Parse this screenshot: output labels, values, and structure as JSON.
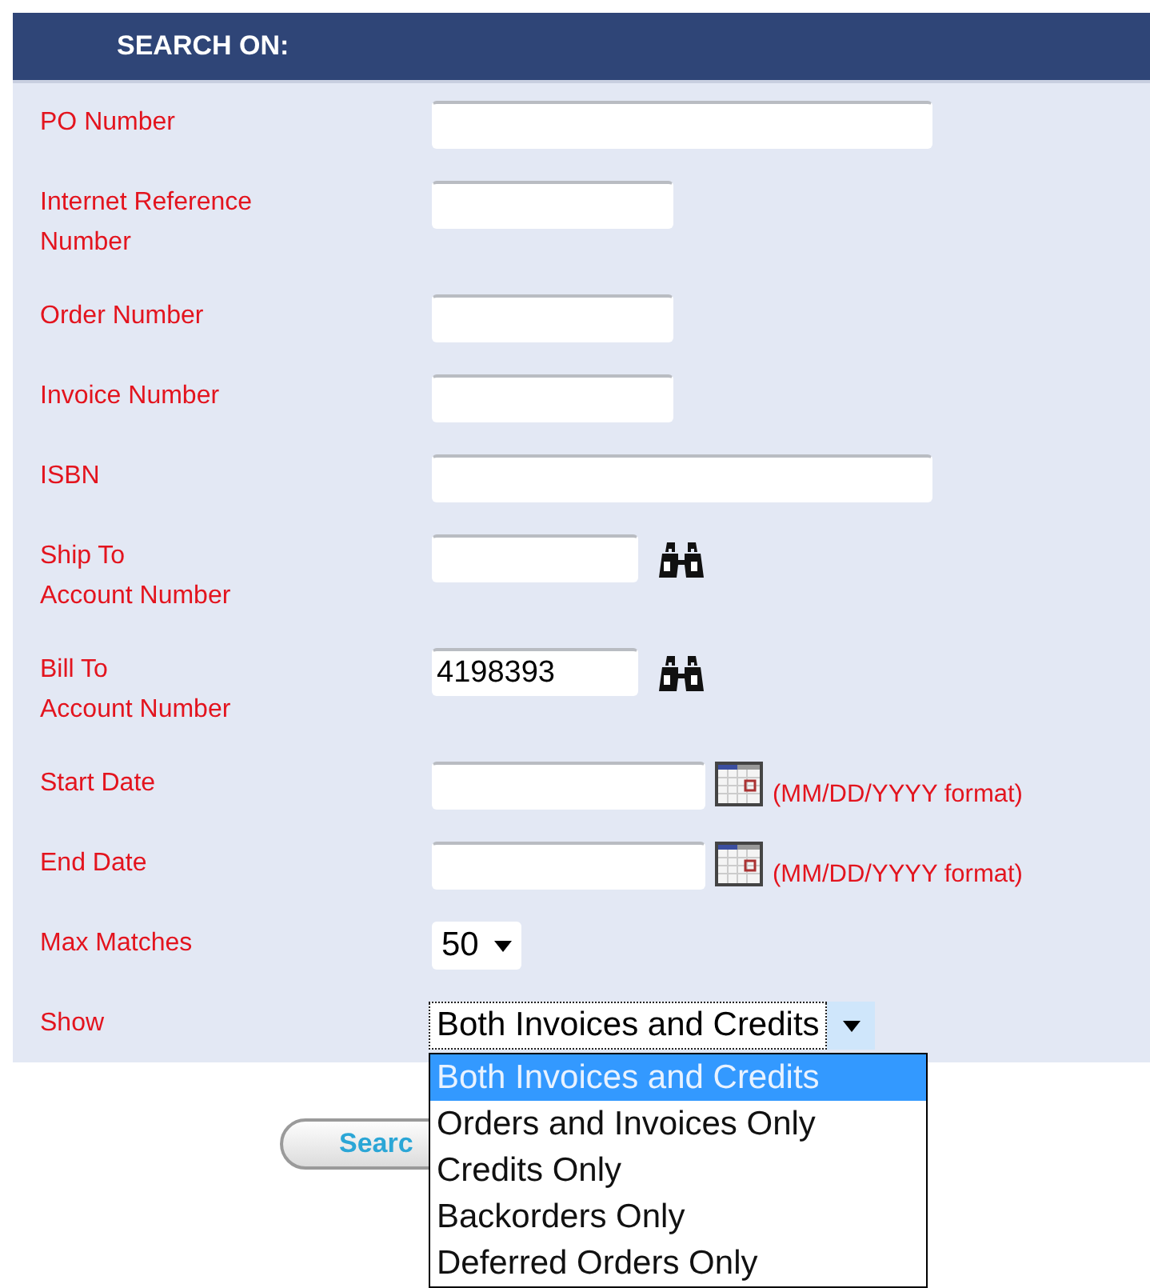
{
  "header": {
    "title": "SEARCH ON:"
  },
  "fields": [
    {
      "label": "PO Number",
      "kind": "text"
    },
    {
      "label": "Internet Reference\nNumber",
      "kind": "text"
    },
    {
      "label": "Order Number",
      "kind": "text"
    },
    {
      "label": "Invoice Number",
      "kind": "text"
    },
    {
      "label": "ISBN",
      "kind": "text"
    },
    {
      "label": "Ship To\nAccount Number",
      "kind": "lookup"
    },
    {
      "label": "Bill To\nAccount Number",
      "kind": "lookup",
      "value": "4198393"
    },
    {
      "label": "Start Date",
      "kind": "date",
      "hint": "(MM/DD/YYYY format)"
    },
    {
      "label": "End Date",
      "kind": "date",
      "hint": "(MM/DD/YYYY format)"
    },
    {
      "label": "Max Matches",
      "kind": "select",
      "value": "50",
      "expanded": false
    },
    {
      "label": "Show",
      "kind": "select",
      "value": "Both Invoices and Credits",
      "expanded": true,
      "options": [
        {
          "label": "Both Invoices and Credits",
          "selected": true
        },
        {
          "label": "Orders and Invoices Only",
          "selected": false
        },
        {
          "label": "Credits Only",
          "selected": false
        },
        {
          "label": "Backorders Only",
          "selected": false
        },
        {
          "label": "Deferred Orders Only",
          "selected": false
        }
      ]
    }
  ],
  "search_button": {
    "label": "Searc"
  }
}
